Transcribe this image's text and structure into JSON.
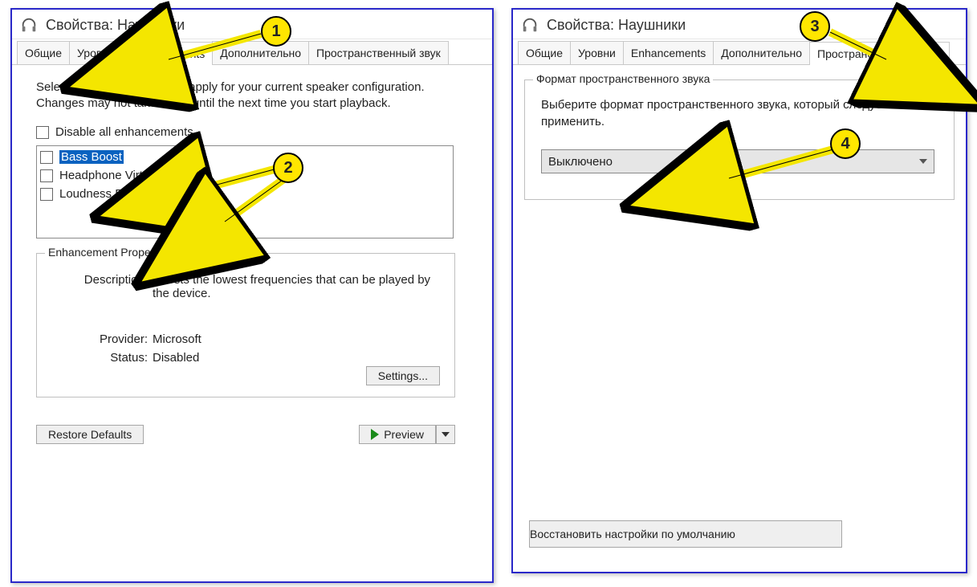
{
  "left": {
    "title": "Свойства: Наушники",
    "tabs": [
      "Общие",
      "Уровни",
      "Enhancements",
      "Дополнительно",
      "Пространственный звук"
    ],
    "active_tab": "Enhancements",
    "intro": "Select the enhancements to apply for your current speaker configuration. Changes may not take effect until the next time you start playback.",
    "disable_all_label": "Disable all enhancements",
    "enhancements": [
      {
        "label": "Bass Boost",
        "selected": true
      },
      {
        "label": "Headphone Virtualization",
        "selected": false
      },
      {
        "label": "Loudness Equalization",
        "selected": false
      }
    ],
    "props_legend": "Enhancement Properties",
    "desc_label": "Description:",
    "desc_val": "Boosts the lowest frequencies that can be played by the device.",
    "provider_label": "Provider:",
    "provider_val": "Microsoft",
    "status_label": "Status:",
    "status_val": "Disabled",
    "settings_btn": "Settings...",
    "restore_btn": "Restore Defaults",
    "preview_btn": "Preview"
  },
  "right": {
    "title": "Свойства: Наушники",
    "tabs": [
      "Общие",
      "Уровни",
      "Enhancements",
      "Дополнительно",
      "Пространственный звук"
    ],
    "active_tab": "Пространственный звук",
    "group_legend": "Формат пространственного звука",
    "instr": "Выберите формат пространственного звука, который следует применить.",
    "combo_value": "Выключено",
    "restore_btn": "Восстановить настройки по умолчанию"
  },
  "markers": {
    "m1": "1",
    "m2": "2",
    "m3": "3",
    "m4": "4"
  }
}
